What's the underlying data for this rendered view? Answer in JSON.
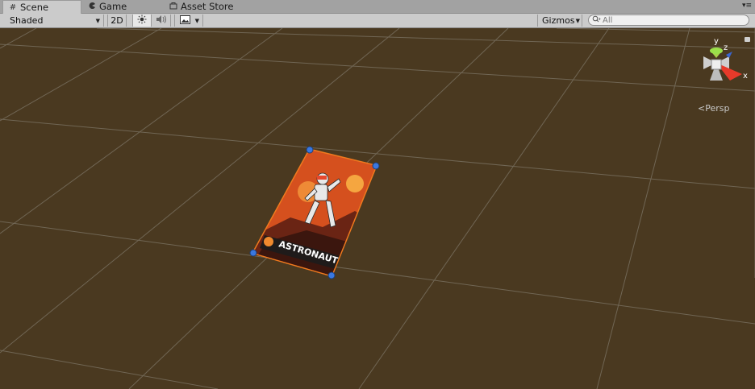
{
  "tabs": [
    {
      "label": "Scene",
      "icon": "grid-icon",
      "active": true
    },
    {
      "label": "Game",
      "icon": "pacman-icon",
      "active": false
    },
    {
      "label": "Asset Store",
      "icon": "store-bag-icon",
      "active": false
    }
  ],
  "toolbar": {
    "draw_mode": "Shaded",
    "mode_2d": "2D",
    "lighting_icon": "sun-icon",
    "audio_icon": "speaker-icon",
    "effects_icon": "image-icon",
    "gizmos_label": "Gizmos",
    "search_placeholder": "All"
  },
  "scene": {
    "projection_label": "Persp",
    "gizmo_axes": {
      "y": "y",
      "z": "z",
      "x": "x"
    },
    "card_title": "ASTRONAUT"
  },
  "colors": {
    "ground": "#4a3920",
    "grid_line": "#8a8274",
    "selection_outline": "#f07a1e",
    "handle": "#3a78e0",
    "card_bg": "#d94b1a",
    "card_sun": "#f5a640"
  }
}
